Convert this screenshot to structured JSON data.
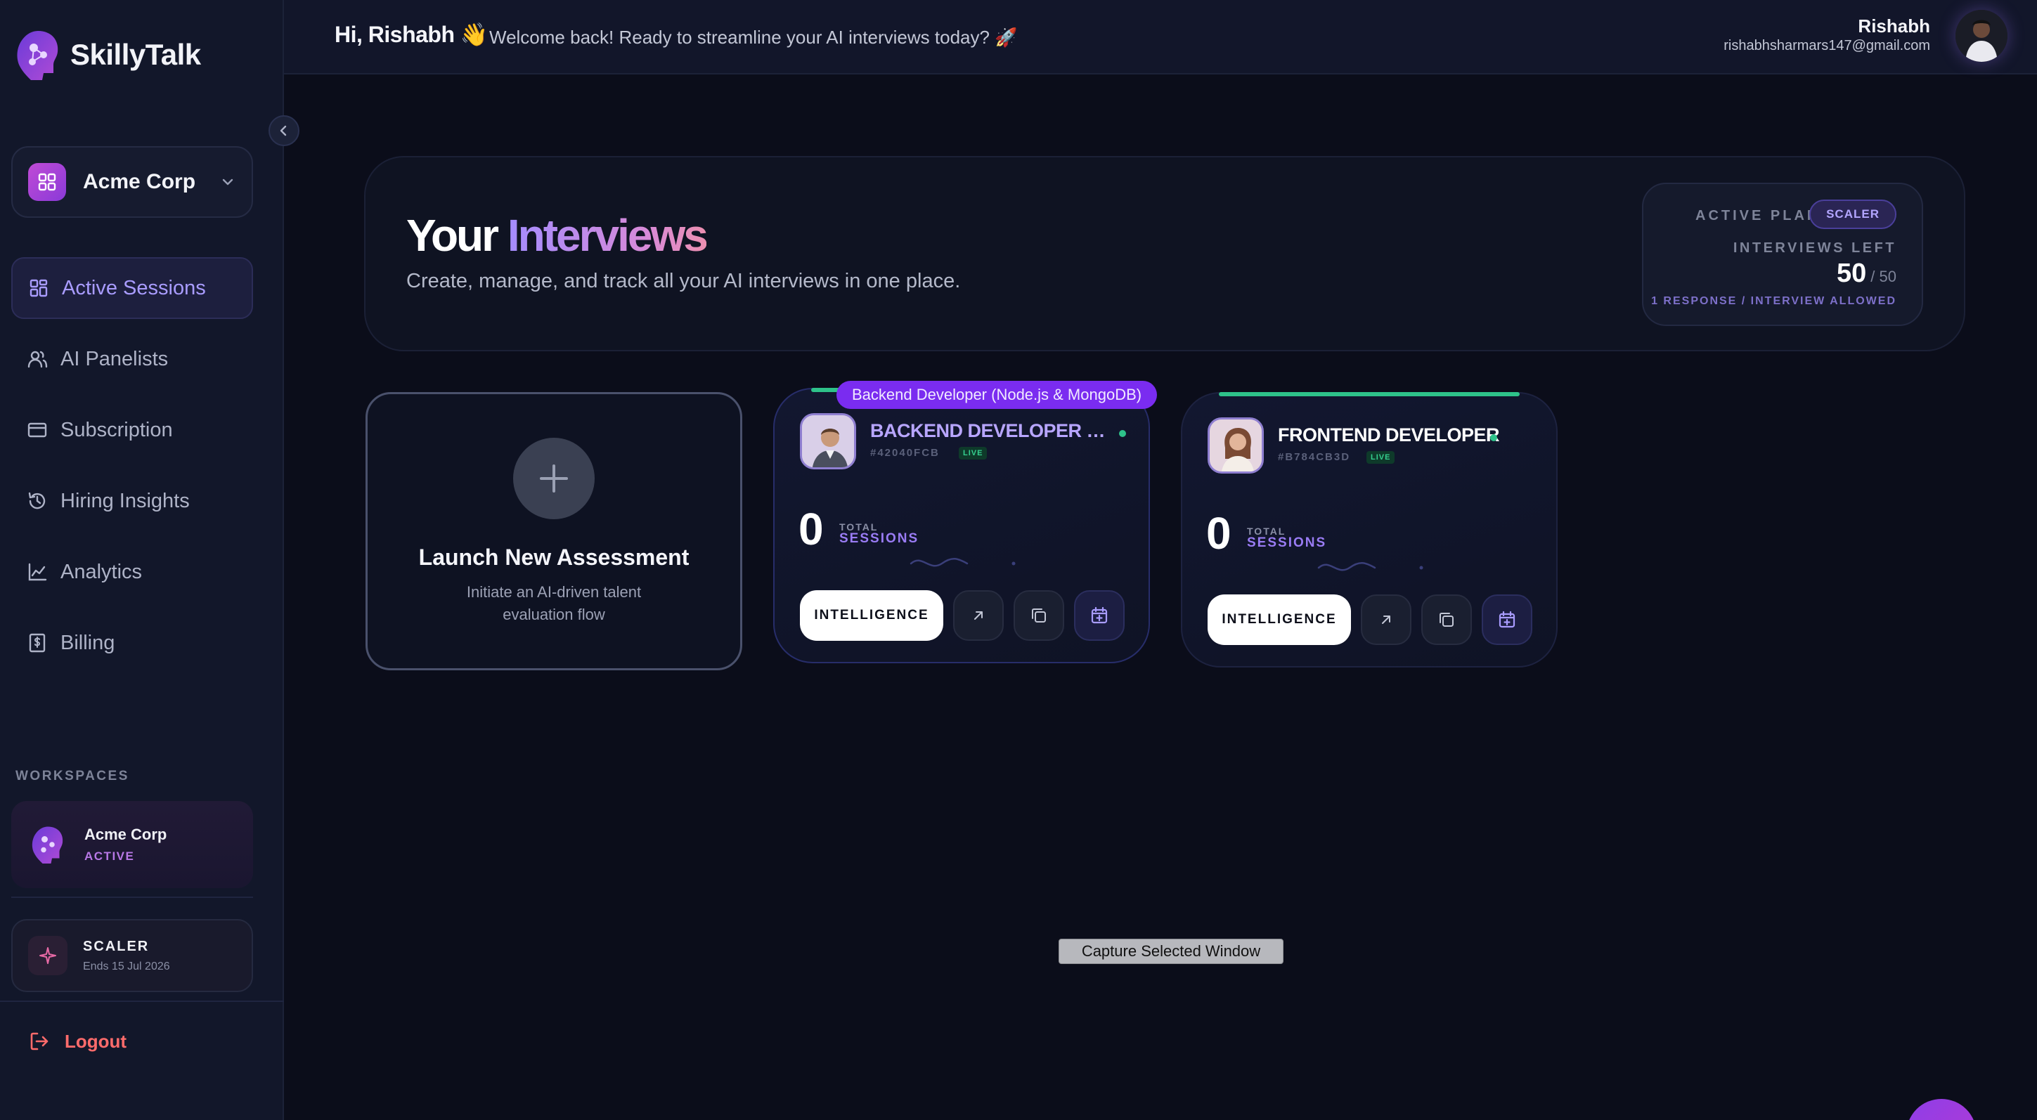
{
  "brand": {
    "name": "SkillyTalk"
  },
  "org_selector": {
    "name": "Acme Corp"
  },
  "nav": [
    {
      "label": "Active Sessions",
      "icon": "grid-icon",
      "active": true
    },
    {
      "label": "AI Panelists",
      "icon": "users-icon",
      "active": false
    },
    {
      "label": "Subscription",
      "icon": "card-icon",
      "active": false
    },
    {
      "label": "Hiring Insights",
      "icon": "history-icon",
      "active": false
    },
    {
      "label": "Analytics",
      "icon": "chart-line-icon",
      "active": false
    },
    {
      "label": "Billing",
      "icon": "receipt-icon",
      "active": false
    }
  ],
  "workspaces": {
    "label": "WORKSPACES",
    "current": {
      "name": "Acme Corp",
      "status": "ACTIVE"
    }
  },
  "plan_card": {
    "name": "SCALER",
    "ends": "Ends 15 Jul 2026"
  },
  "logout": {
    "label": "Logout"
  },
  "header": {
    "greeting": "Hi, Rishabh 👋",
    "welcome": "Welcome back! Ready to streamline your AI interviews today? 🚀",
    "user_name": "Rishabh",
    "user_email": "rishabhsharmars147@gmail.com"
  },
  "hero": {
    "title_part1": "Your",
    "title_part2": "Interviews",
    "subtitle": "Create, manage, and track all your AI interviews in one place.",
    "plan": {
      "label": "ACTIVE PLAN",
      "badge": "SCALER",
      "left_label": "INTERVIEWS LEFT",
      "left_count": "50",
      "left_total": "/ 50",
      "note": "1 RESPONSE / INTERVIEW ALLOWED"
    }
  },
  "launch": {
    "title": "Launch New Assessment",
    "description": "Initiate an AI-driven talent evaluation flow"
  },
  "interviews": [
    {
      "tooltip": "Backend Developer (Node.js & MongoDB)",
      "title": "BACKEND DEVELOPER (N...",
      "code": "#42040FCB",
      "live": "LIVE",
      "sessions": "0",
      "sessions_label1": "TOTAL",
      "sessions_label2": "SESSIONS",
      "action": "INTELLIGENCE",
      "title_color": "#b8a6ff"
    },
    {
      "tooltip": "",
      "title": "FRONTEND DEVELOPER",
      "code": "#B784CB3D",
      "live": "LIVE",
      "sessions": "0",
      "sessions_label1": "TOTAL",
      "sessions_label2": "SESSIONS",
      "action": "INTELLIGENCE",
      "title_color": "#ffffff"
    }
  ],
  "system": {
    "capture_label": "Capture Selected Window"
  },
  "colors": {
    "accent": "#a99cff",
    "live": "#2ec28a",
    "danger": "#ff6b6b",
    "brand_purple": "#8a3ad8"
  }
}
